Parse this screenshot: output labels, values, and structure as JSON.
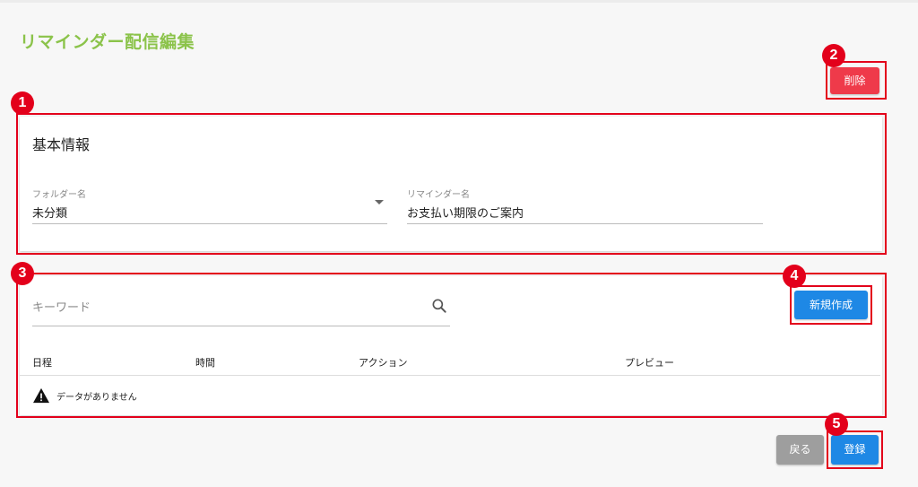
{
  "page": {
    "title": "リマインダー配信編集"
  },
  "actions": {
    "delete_label": "削除",
    "back_label": "戻る",
    "register_label": "登録"
  },
  "basic_info": {
    "section_title": "基本情報",
    "folder": {
      "label": "フォルダー名",
      "value": "未分類"
    },
    "reminder_name": {
      "label": "リマインダー名",
      "value": "お支払い期限のご案内"
    }
  },
  "schedule_list": {
    "search": {
      "placeholder": "キーワード",
      "value": ""
    },
    "new_button_label": "新規作成",
    "columns": [
      "日程",
      "時間",
      "アクション",
      "プレビュー"
    ],
    "rows": [],
    "empty_message": "データがありません"
  },
  "annotations": {
    "markers": [
      "1",
      "2",
      "3",
      "4",
      "5"
    ],
    "color": "#e3001b"
  },
  "colors": {
    "title": "#8bc34a",
    "primary": "#1e88e5",
    "danger": "#ef3a4a",
    "neutral": "#9e9e9e"
  },
  "icons": {
    "search": "search-icon",
    "warning": "warning-icon",
    "dropdown": "chevron-down-icon"
  }
}
